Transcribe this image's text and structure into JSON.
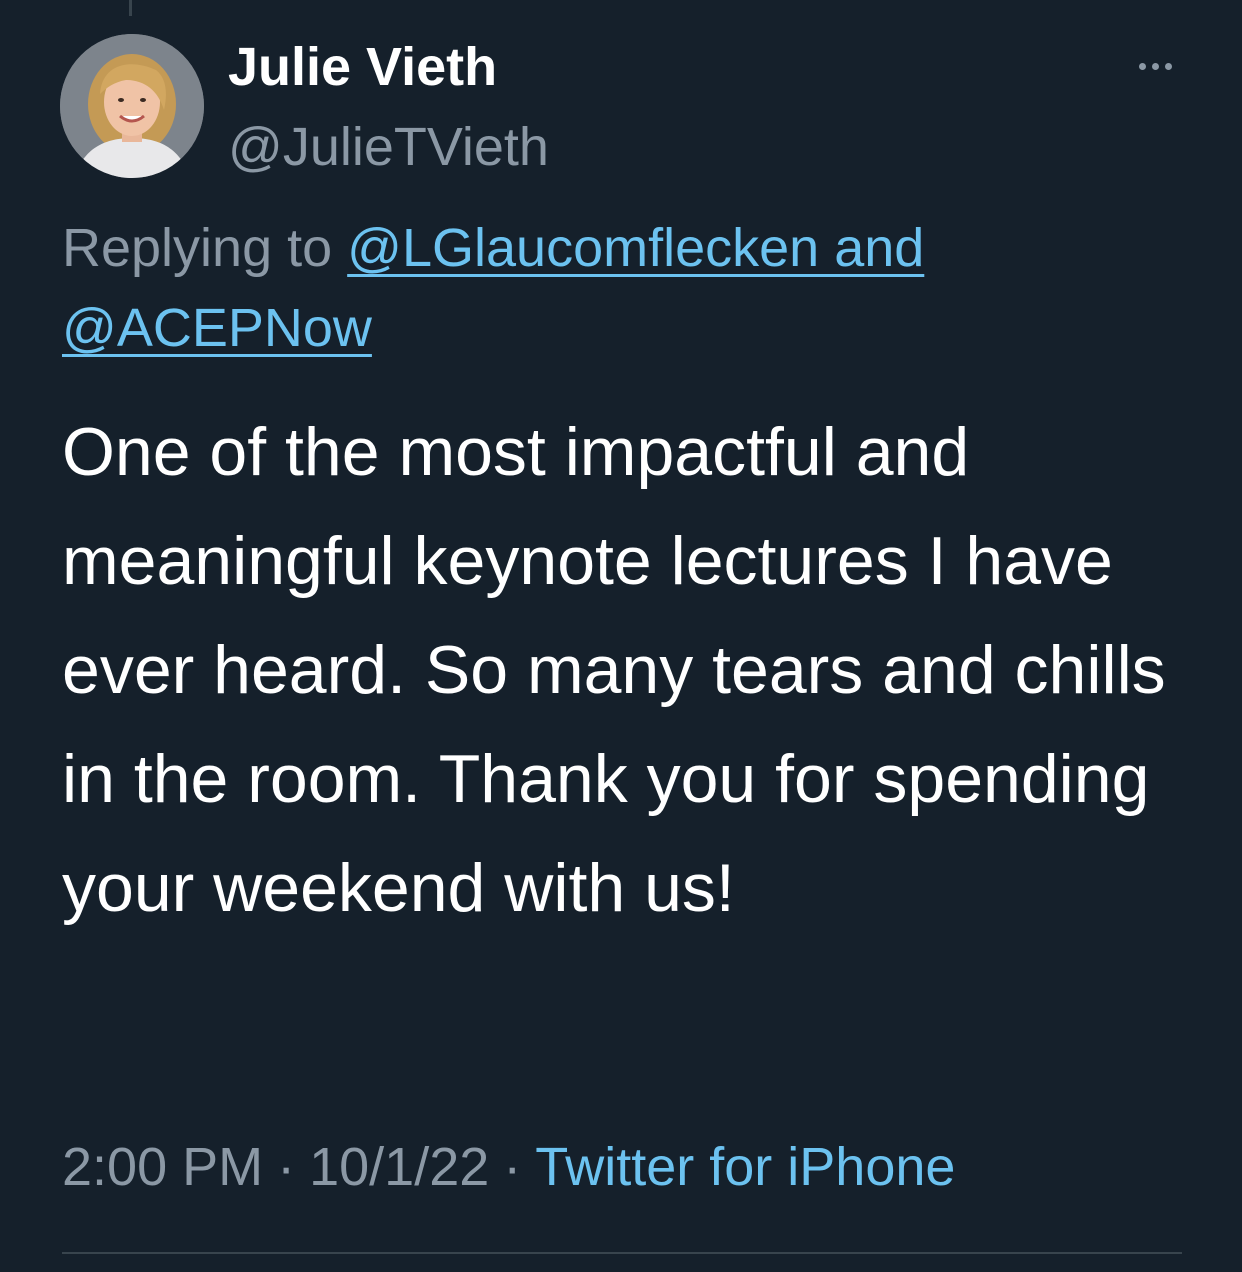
{
  "tweet": {
    "author": {
      "display_name": "Julie Vieth",
      "handle": "@JulieTVieth",
      "avatar_icon": "profile-photo"
    },
    "more_icon": "ellipsis-icon",
    "reply_context": {
      "prefix": "Replying to ",
      "mention_line_1": "@LGlaucomflecken and",
      "mention_line_2": "@ACEPNow"
    },
    "text": "One of the most impactful and meaningful keynote lectures I have ever heard. So many tears and chills in the room. Thank you for spending your weekend with us!",
    "time": "2:00 PM",
    "separator": "·",
    "date": "10/1/22",
    "source": "Twitter for iPhone"
  },
  "colors": {
    "background": "#15202b",
    "primary_text": "#ffffff",
    "secondary_text": "#8b98a5",
    "link": "#6cc2f0",
    "divider": "#38444d"
  }
}
